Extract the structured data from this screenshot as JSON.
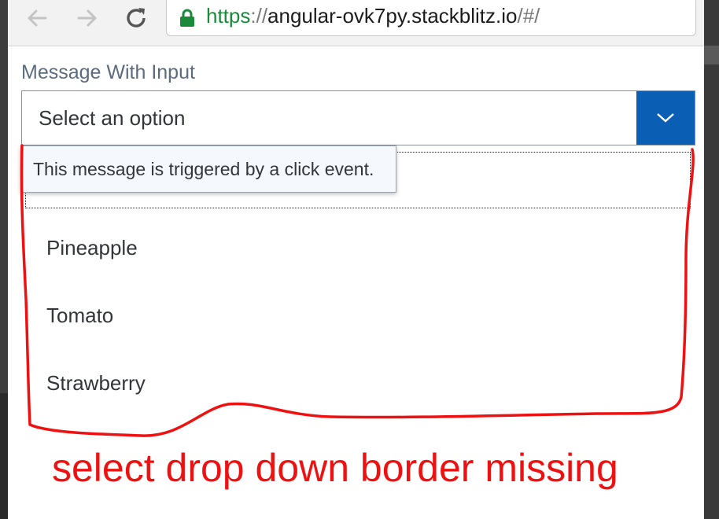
{
  "browser": {
    "url_protocol": "https",
    "url_separator": "://",
    "url_host": "angular-ovk7py.stackblitz.io",
    "url_path": "/#/",
    "icons": [
      "back-arrow-icon",
      "forward-arrow-icon",
      "reload-icon",
      "lock-icon"
    ]
  },
  "form": {
    "label": "Message With Input",
    "select_value": "Select an option",
    "arrow_icon": "chevron-down-icon",
    "accent_color": "#0a5fb4"
  },
  "dropdown": {
    "items": [
      {
        "label": "Pineapple"
      },
      {
        "label": "Tomato"
      },
      {
        "label": "Strawberry"
      }
    ]
  },
  "message": {
    "text": "This message is triggered by a click event."
  },
  "annotation": {
    "text": "select drop down border missing",
    "color": "#ee1111"
  }
}
